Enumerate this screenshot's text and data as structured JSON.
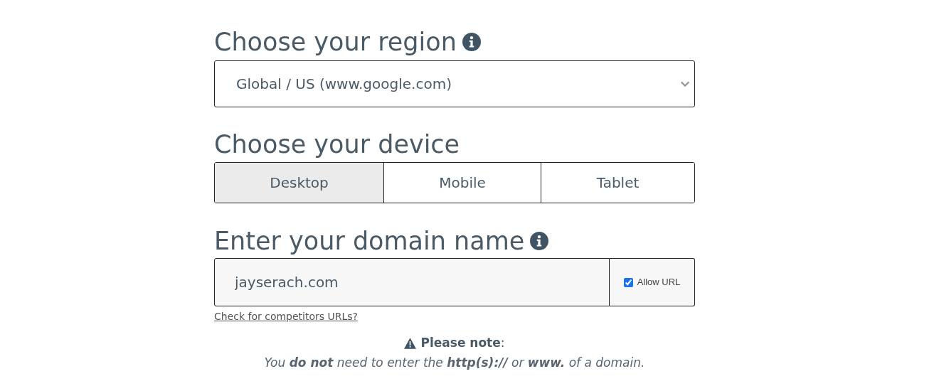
{
  "region": {
    "heading": "Choose your region",
    "value": "Global / US (www.google.com)"
  },
  "device": {
    "heading": "Choose your device",
    "options": [
      {
        "label": "Desktop",
        "selected": true
      },
      {
        "label": "Mobile",
        "selected": false
      },
      {
        "label": "Tablet",
        "selected": false
      }
    ]
  },
  "domain": {
    "heading": "Enter your domain name",
    "value": "jayserach.com",
    "allow_url": {
      "label": "Allow URL",
      "checked": true
    }
  },
  "competitors_link": "Check for competitors URLs?",
  "note": {
    "title": "**Please note**:",
    "text": "You **do not** need to enter the **http(s)://** or **www.** of a domain."
  }
}
